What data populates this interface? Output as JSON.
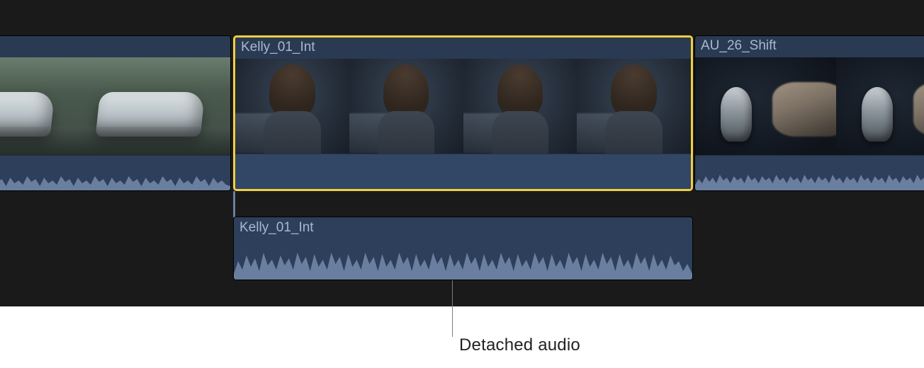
{
  "timeline": {
    "clips": [
      {
        "id": "c1",
        "label": ""
      },
      {
        "id": "c2",
        "label": "Kelly_01_Int"
      },
      {
        "id": "c3",
        "label": "AU_26_Shift"
      }
    ],
    "detached_audio": {
      "label": "Kelly_01_Int"
    }
  },
  "annotation": {
    "label": "Detached audio"
  }
}
